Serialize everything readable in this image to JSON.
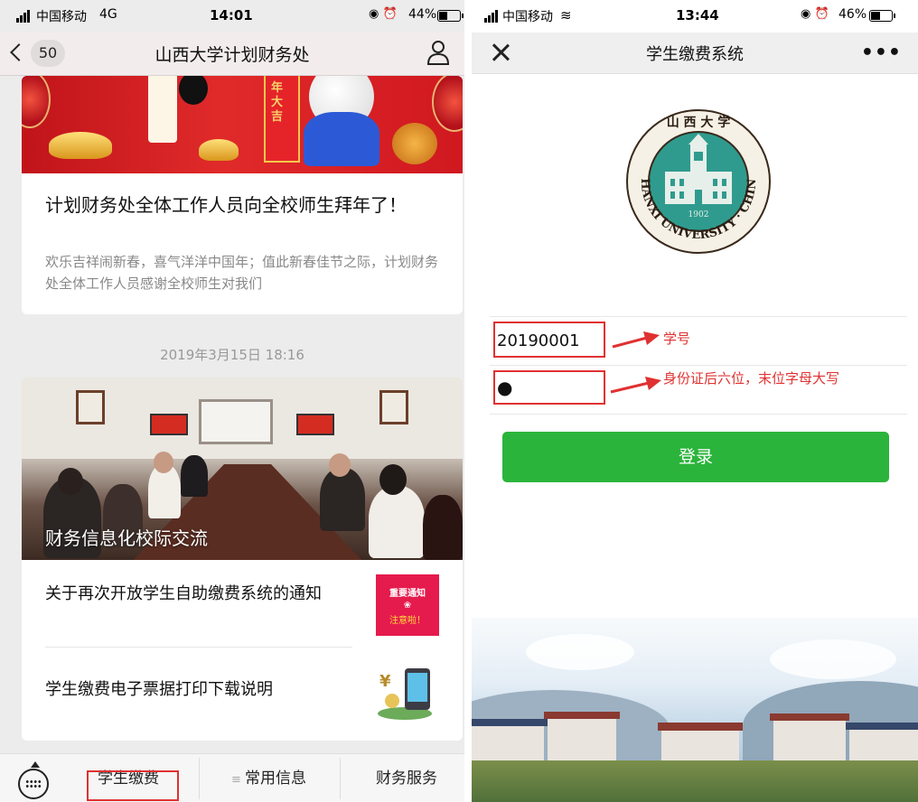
{
  "left": {
    "status": {
      "carrier": "中国移动",
      "network": "4G",
      "time": "14:01",
      "battery": "44%",
      "battery_level": 0.44
    },
    "nav": {
      "back_count": "50",
      "title": "山西大学计划财务处"
    },
    "article1": {
      "banner_text": "年大吉",
      "title": "计划财务处全体工作人员向全校师生拜年了！",
      "excerpt": "欢乐吉祥闹新春，喜气洋洋中国年；值此新春佳节之际，计划财务处全体工作人员感谢全校师生对我们"
    },
    "datestamp": "2019年3月15日 18:16",
    "article2": {
      "caption": "财务信息化校际交流",
      "items": [
        {
          "title": "关于再次开放学生自助缴费系统的通知",
          "thumb_line1": "重要通知",
          "thumb_line2": "注意啦！"
        },
        {
          "title": "学生缴费电子票据打印下载说明"
        }
      ]
    },
    "tabbar": {
      "tab1": "学生缴费",
      "tab2": "常用信息",
      "tab3": "财务服务"
    }
  },
  "right": {
    "status": {
      "carrier": "中国移动",
      "time": "13:44",
      "battery": "46%",
      "battery_level": 0.46
    },
    "nav": {
      "title": "学生缴费系统",
      "more": "•••"
    },
    "seal": {
      "text": "SHANXI UNIVERSITY · CHINA",
      "year": "1902",
      "top_chars": "山 西 大 学"
    },
    "form": {
      "student_id_value": "20190001",
      "password_value": "●",
      "annotation_id": "学号",
      "annotation_password": "身份证后六位，末位字母大写",
      "login_label": "登录"
    }
  },
  "colors": {
    "accent_green": "#2bb43b",
    "annotation_red": "#e03131"
  }
}
